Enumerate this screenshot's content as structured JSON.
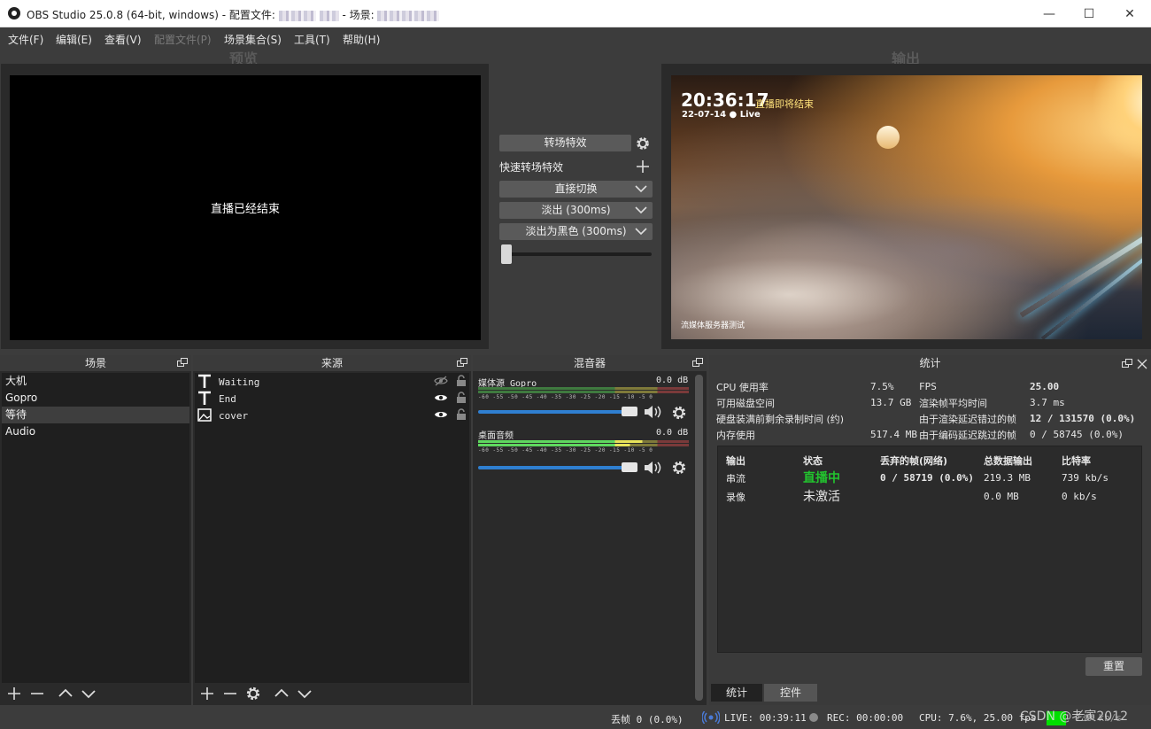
{
  "window": {
    "title_prefix": "OBS Studio 25.0.8 (64-bit, windows) - 配置文件:",
    "title_middle": "- 场景:",
    "minimize_glyph": "—",
    "maximize_glyph": "☐",
    "close_glyph": "✕"
  },
  "menu": [
    "文件(F)",
    "编辑(E)",
    "查看(V)",
    "配置文件(P)",
    "场景集合(S)",
    "工具(T)",
    "帮助(H)"
  ],
  "headers": {
    "preview": "预览",
    "program": "输出"
  },
  "preview": {
    "message": "直播已经结束"
  },
  "transition": {
    "studio_button": "转场特效",
    "quick_label": "快速转场特效",
    "options": [
      "直接切换",
      "淡出 (300ms)",
      "淡出为黑色 (300ms)"
    ],
    "tbar_value": 0
  },
  "program": {
    "clock": "20:36:17",
    "date_live": "22-07-14 ● Live",
    "notice": "直播即将结束",
    "footer": "流媒体服务器测试"
  },
  "scenes": {
    "title": "场景",
    "items": [
      "大机",
      "Gopro",
      "等待",
      "Audio"
    ],
    "selected_index": 2
  },
  "sources": {
    "title": "来源",
    "items": [
      {
        "name": "Waiting",
        "type": "text",
        "visible": false
      },
      {
        "name": "End",
        "type": "text",
        "visible": true
      },
      {
        "name": "cover",
        "type": "image",
        "visible": true
      }
    ]
  },
  "mixer": {
    "title": "混音器",
    "channels": [
      {
        "name": "媒体源 Gopro",
        "db": "0.0 dB",
        "volume": 1.0
      },
      {
        "name": "桌面音频",
        "db": "0.0 dB",
        "volume": 1.0
      }
    ],
    "ticks": "-60 -55 -50 -45 -40 -35 -30 -25 -20 -15 -10 -5 0"
  },
  "stats": {
    "title": "统计",
    "left": [
      {
        "label": "CPU 使用率",
        "value": "7.5%"
      },
      {
        "label": "可用磁盘空间",
        "value": "13.7 GB"
      },
      {
        "label": "硬盘装满前剩余录制时间 (约)",
        "value": ""
      },
      {
        "label": "内存使用",
        "value": "517.4 MB"
      }
    ],
    "right": [
      {
        "label": "FPS",
        "value": "25.00"
      },
      {
        "label": "渲染帧平均时间",
        "value": "3.7 ms"
      },
      {
        "label": "由于渲染延迟错过的帧",
        "value": "12 / 131570 (0.0%)"
      },
      {
        "label": "由于编码延迟跳过的帧",
        "value": "0 / 58745 (0.0%)"
      }
    ],
    "table": {
      "headers": [
        "输出",
        "状态",
        "丢弃的帧(网络)",
        "总数据输出",
        "比特率"
      ],
      "rows": [
        {
          "output": "串流",
          "status": "直播中",
          "dropped": "0 / 58719 (0.0%)",
          "total": "219.3 MB",
          "bitrate": "739 kb/s"
        },
        {
          "output": "录像",
          "status": "未激活",
          "dropped": "",
          "total": "0.0 MB",
          "bitrate": "0 kb/s"
        }
      ]
    },
    "reset_button": "重置",
    "tabs": [
      "统计",
      "控件"
    ]
  },
  "statusbar": {
    "dropped": "丢帧 0 (0.0%)",
    "live": "LIVE: 00:39:11",
    "rec": "REC: 00:00:00",
    "cpu": "CPU: 7.6%, 25.00 fps",
    "bitrate": "739 kb/s",
    "watermark": "CSDN @老寅2012"
  },
  "colors": {
    "live_status": "#22c32e",
    "accent_slider": "#2f7fd1",
    "status_square": "#00e000"
  }
}
